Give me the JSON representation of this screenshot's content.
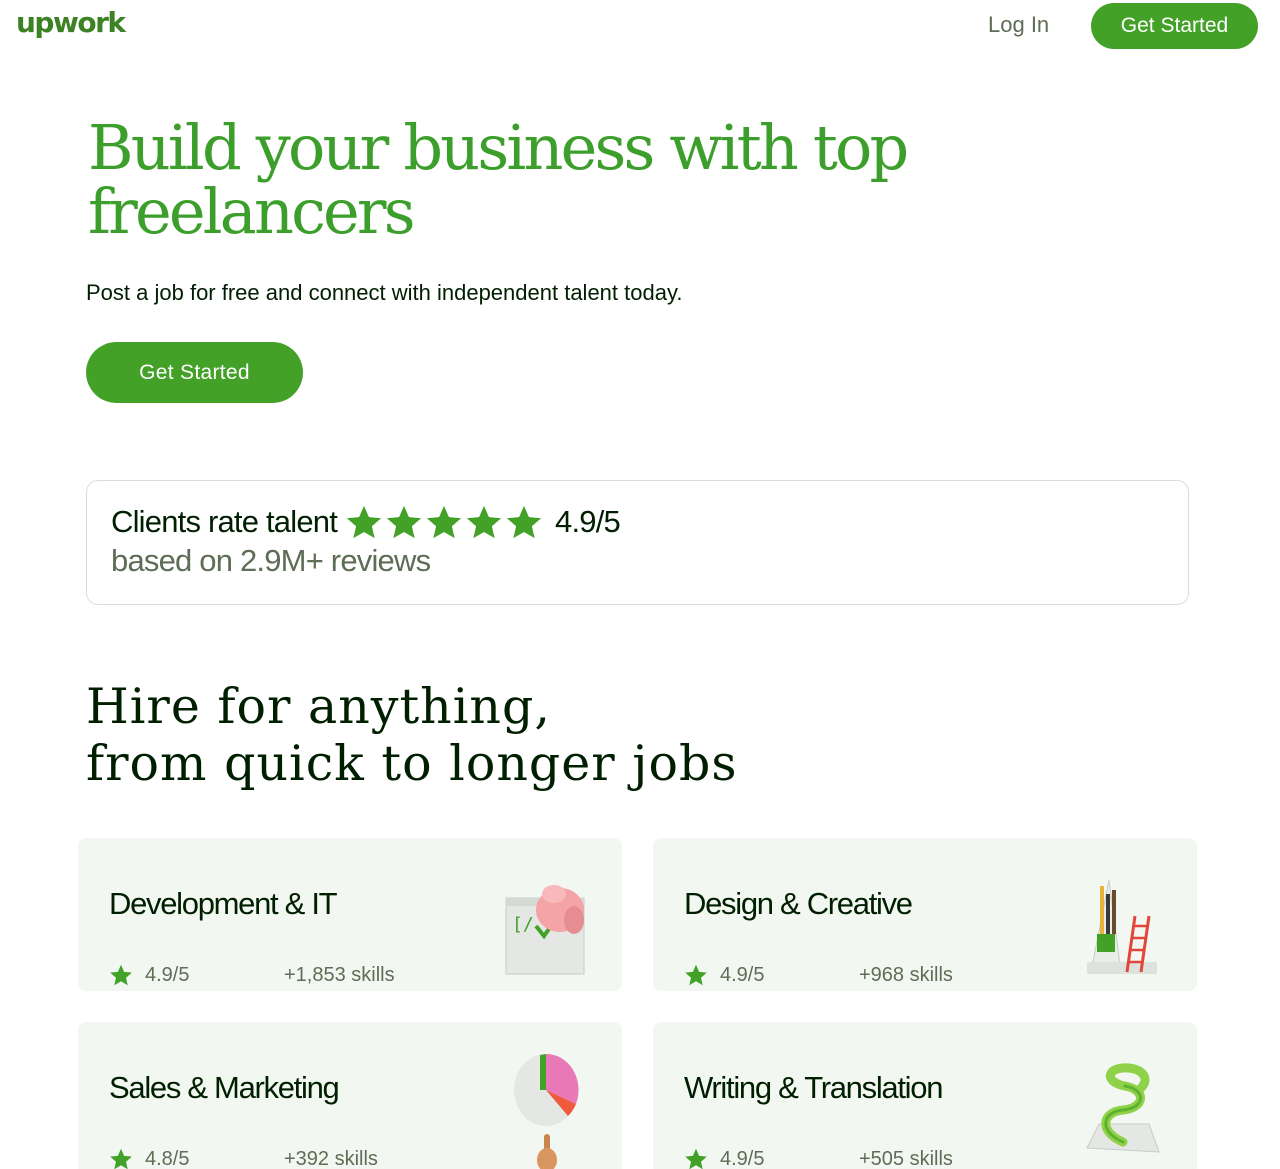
{
  "header": {
    "logo": "upwork",
    "login_label": "Log In",
    "cta_label": "Get Started"
  },
  "hero": {
    "title_line1": "Build your business with top",
    "title_line2": "freelancers",
    "subtitle": "Post a job for free and connect with independent talent today.",
    "cta_label": "Get Started"
  },
  "rating": {
    "label": "Clients rate talent",
    "stars": 5,
    "score": "4.9/5",
    "reviews": "based on 2.9M+ reviews"
  },
  "section": {
    "title_line1": "Hire for anything,",
    "title_line2": "from quick to longer jobs"
  },
  "categories": [
    {
      "title": "Development & IT",
      "rating": "4.9/5",
      "skills": "+1,853 skills",
      "icon": "code-window-hand-icon"
    },
    {
      "title": "Design & Creative",
      "rating": "4.9/5",
      "skills": "+968 skills",
      "icon": "pencils-ladder-icon"
    },
    {
      "title": "Sales & Marketing",
      "rating": "4.8/5",
      "skills": "+392 skills",
      "icon": "pie-chart-hand-icon"
    },
    {
      "title": "Writing & Translation",
      "rating": "4.9/5",
      "skills": "+505 skills",
      "icon": "spiral-icon"
    }
  ],
  "colors": {
    "brand_green": "#43a128",
    "heading_green": "#3c9f2b",
    "text_dark": "#001e00",
    "text_muted": "#5e6d55",
    "card_bg": "#f2f7f2"
  }
}
